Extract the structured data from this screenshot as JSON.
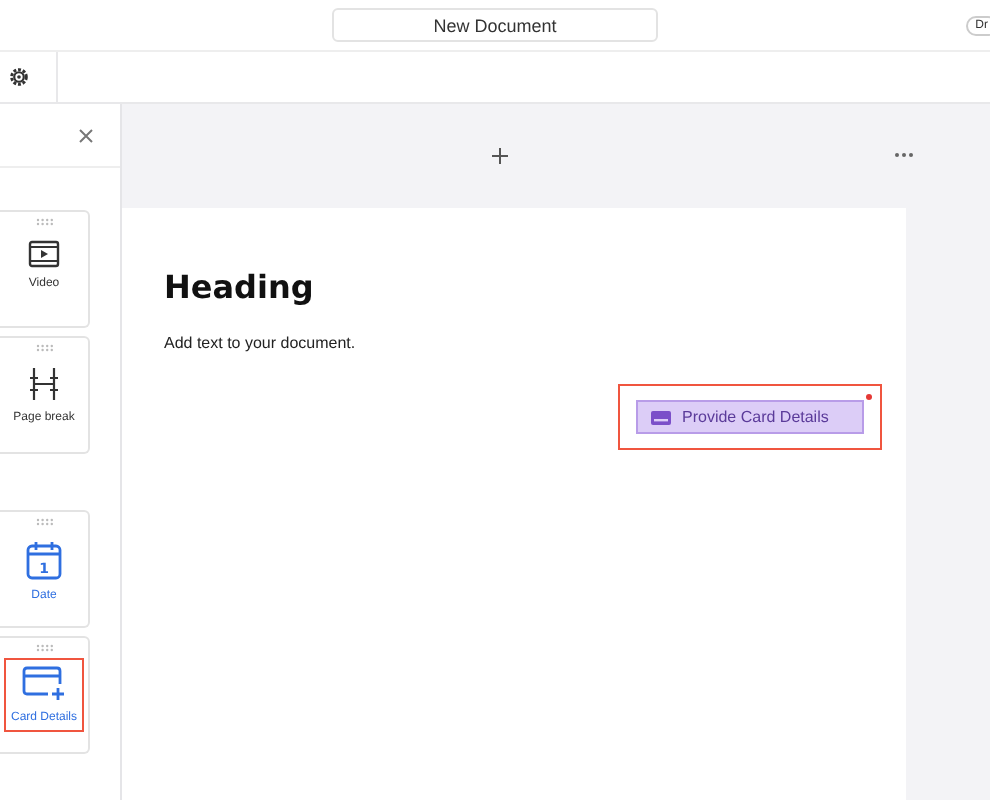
{
  "header": {
    "title": "New Document",
    "badge": "Dr"
  },
  "blocks": [
    {
      "kind": "video",
      "label": "Video",
      "color": "#333333",
      "highlighted": false
    },
    {
      "kind": "page-break",
      "label": "Page break",
      "color": "#333333",
      "highlighted": false
    },
    {
      "kind": "date",
      "label": "Date",
      "icon_text": "1",
      "color": "#2f6fe0",
      "highlighted": false
    },
    {
      "kind": "card",
      "label": "Card Details",
      "color": "#2f6fe0",
      "highlighted": true
    }
  ],
  "document": {
    "heading": "Heading",
    "body": "Add text to your document.",
    "field": {
      "label": "Provide Card Details",
      "required": true,
      "highlighted": true
    }
  }
}
